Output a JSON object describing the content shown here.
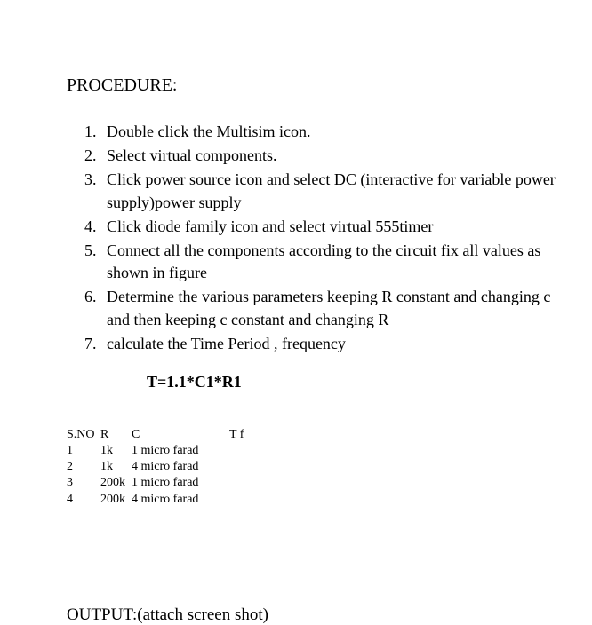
{
  "heading": "PROCEDURE:",
  "steps": [
    {
      "num": "1.",
      "text": "Double click the Multisim icon."
    },
    {
      "num": "2.",
      "text": "Select virtual components."
    },
    {
      "num": "3.",
      "text": "Click power source icon and select DC (interactive for variable power supply)power supply"
    },
    {
      "num": "4.",
      "text": "Click diode family icon and select virtual 555timer"
    },
    {
      "num": "5.",
      "text": "Connect all the components according to the circuit fix all values as shown in figure"
    },
    {
      "num": "6.",
      "text": "Determine the various parameters keeping R constant and changing c  and then keeping c constant and changing R"
    },
    {
      "num": "7.",
      "text": "calculate the Time Period , frequency"
    }
  ],
  "formula": "T=1.1*C1*R1",
  "table": {
    "headers": {
      "sno": "S.NO",
      "r": "R",
      "c": "C",
      "tf": "T f"
    },
    "rows": [
      {
        "sno": "1",
        "r": "1k",
        "c": "1 micro farad",
        "tf": ""
      },
      {
        "sno": "2",
        "r": "1k",
        "c": "4 micro farad",
        "tf": ""
      },
      {
        "sno": "3",
        "r": "200k",
        "c": "1 micro farad",
        "tf": ""
      },
      {
        "sno": "4",
        "r": "200k",
        "c": "4 micro farad",
        "tf": ""
      }
    ]
  },
  "output_label": "OUTPUT:(attach screen shot)"
}
